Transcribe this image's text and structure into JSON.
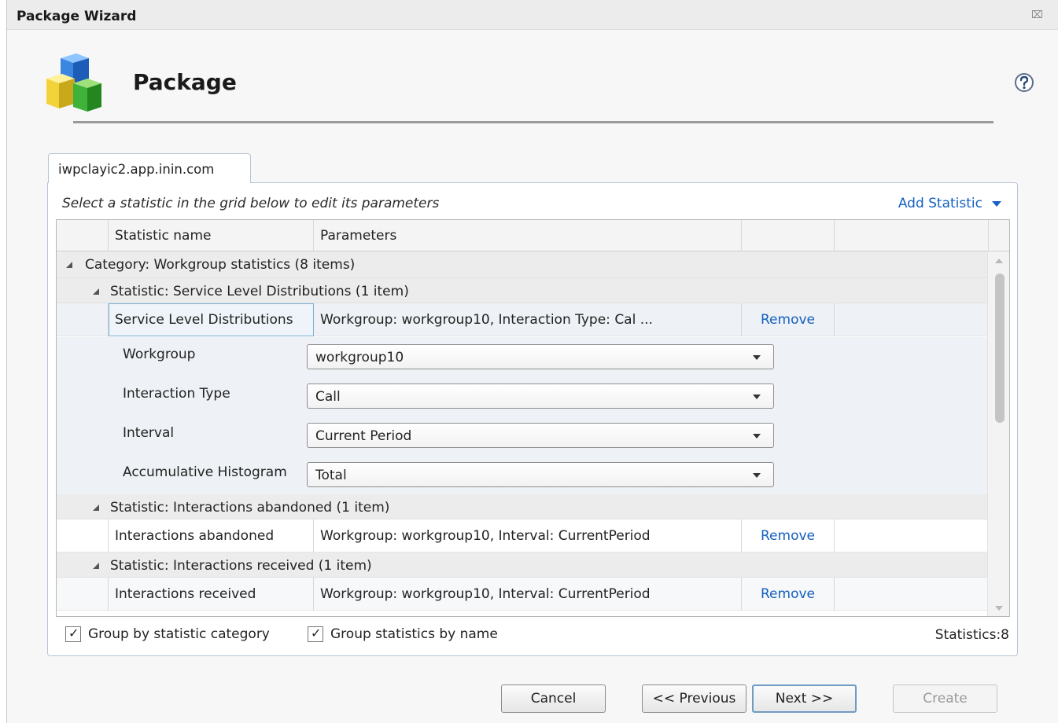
{
  "window": {
    "title": "Package Wizard",
    "close_glyph": "⌧"
  },
  "header": {
    "title": "Package",
    "icon": "package-cubes-icon",
    "help_icon": "help-icon"
  },
  "tab": {
    "label": "iwpclayic2.app.inin.com"
  },
  "panel": {
    "hint": "Select a statistic in the grid below to edit its parameters",
    "add_statistic": "Add Statistic"
  },
  "grid": {
    "columns": [
      "Statistic name",
      "Parameters",
      "",
      ""
    ],
    "category": {
      "label": "Category: Workgroup statistics (8 items)"
    },
    "groups": [
      {
        "label": "Statistic: Service Level Distributions (1 item)",
        "row": {
          "name": "Service Level Distributions",
          "params": "Workgroup: workgroup10, Interaction Type: Cal ...",
          "action": "Remove"
        }
      },
      {
        "label": "Statistic: Interactions abandoned (1 item)",
        "row": {
          "name": "Interactions abandoned",
          "params": "Workgroup: workgroup10, Interval: CurrentPeriod",
          "action": "Remove"
        }
      },
      {
        "label": "Statistic: Interactions received (1 item)",
        "row": {
          "name": "Interactions received",
          "params": "Workgroup: workgroup10, Interval: CurrentPeriod",
          "action": "Remove"
        }
      }
    ],
    "editor": [
      {
        "label": "Workgroup",
        "value": "workgroup10"
      },
      {
        "label": "Interaction Type",
        "value": "Call"
      },
      {
        "label": "Interval",
        "value": "Current Period"
      },
      {
        "label": "Accumulative Histogram",
        "value": "Total"
      }
    ]
  },
  "footer": {
    "group_by_category": "Group by statistic category",
    "group_by_name": "Group statistics by name",
    "statistics_count": "Statistics:8"
  },
  "buttons": {
    "cancel": "Cancel",
    "previous": "<< Previous",
    "next": "Next >>",
    "create": "Create"
  },
  "colors": {
    "link": "#1560c0",
    "group_row": "#ececec",
    "editor_bg": "#eef1f5"
  }
}
